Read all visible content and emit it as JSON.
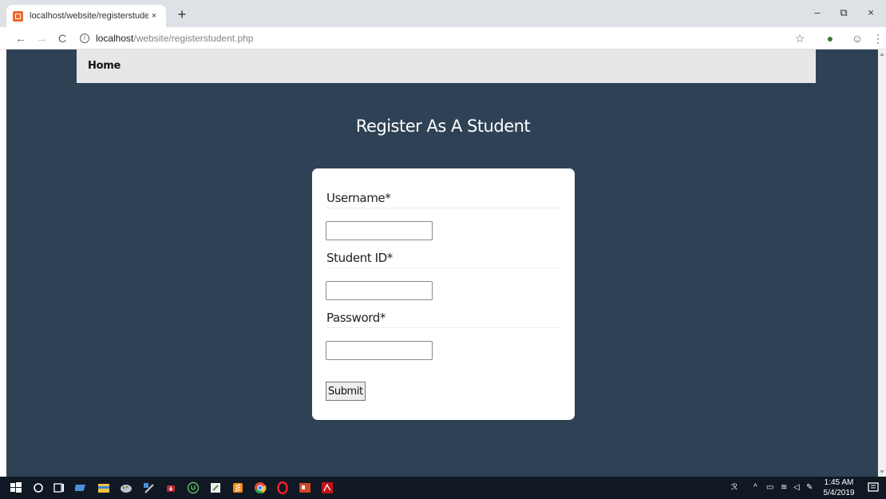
{
  "browser": {
    "tab_title": "localhost/website/registerstuden",
    "tab_close": "×",
    "new_tab": "+",
    "url_host": "localhost",
    "url_path": "/website/registerstudent.php",
    "win_minimize": "–",
    "win_restore": "⧉",
    "win_close": "×"
  },
  "navbar": {
    "home_label": "Home"
  },
  "page": {
    "heading": "Register As A Student"
  },
  "form": {
    "username_label": "Username*",
    "username_value": "",
    "studentid_label": "Student ID*",
    "studentid_value": "",
    "password_label": "Password*",
    "password_value": "",
    "submit_label": "Submit"
  },
  "taskbar": {
    "time": "1:45 AM",
    "date": "5/4/2019"
  },
  "colors": {
    "page_background": "#2f4255",
    "navbar_background": "#e7e7e7",
    "card_background": "#ffffff",
    "taskbar_background": "#101823"
  }
}
